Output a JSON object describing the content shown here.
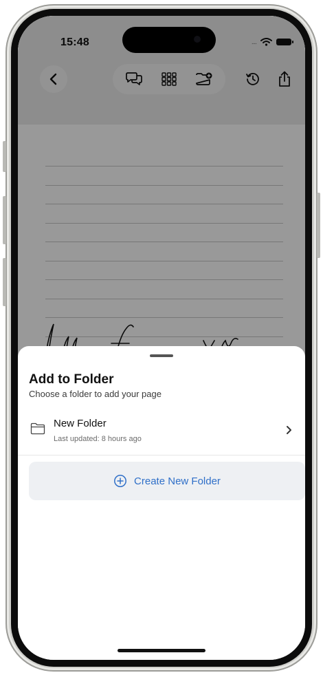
{
  "status": {
    "time": "15:48",
    "signal": "....",
    "icons": [
      "wifi-icon",
      "battery-icon"
    ]
  },
  "toolbar": {
    "icons": [
      "back-chevron-icon",
      "comments-icon",
      "grid-icon",
      "add-folder-icon",
      "history-icon",
      "share-icon"
    ]
  },
  "note": {
    "handwriting": "hell fire XN"
  },
  "sheet": {
    "title": "Add to Folder",
    "subtitle": "Choose a folder to add your page",
    "folders": [
      {
        "name": "New Folder",
        "meta": "Last updated: 8 hours ago"
      }
    ],
    "create_label": "Create New Folder"
  },
  "colors": {
    "accent": "#2f6fc8",
    "button_bg": "#eef0f3",
    "overlay": "rgba(0,0,0,0.40)"
  }
}
